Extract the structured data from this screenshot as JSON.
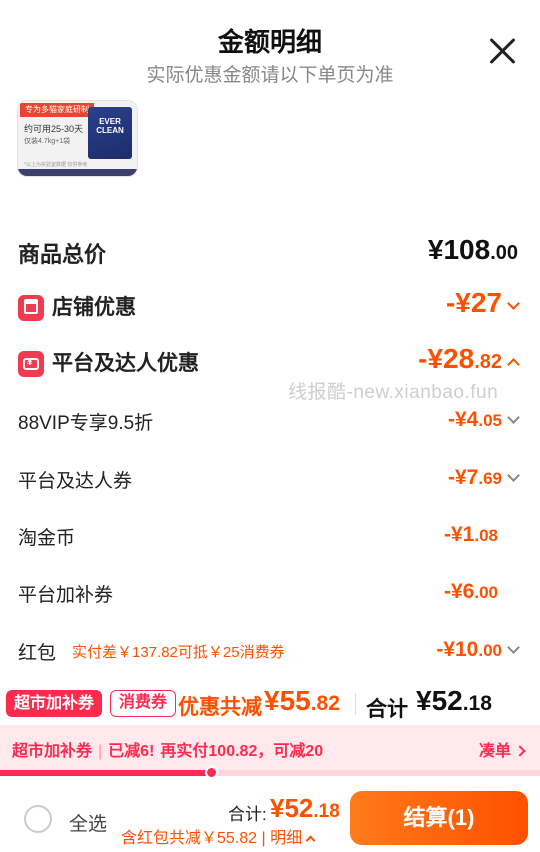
{
  "header": {
    "title": "金额明细",
    "subtitle": "实际优惠金额请以下单页为准"
  },
  "product": {
    "badge": "专为多猫家庭研制",
    "line1": "约可用25-30天",
    "line2": "仅装4.7kg+1袋",
    "brand": "EVER CLEAN",
    "fineprint": "*以上为实验室数据 仅供参考"
  },
  "summary": {
    "total_label": "商品总价",
    "total_int": "¥108",
    "total_dec": ".00",
    "shop_discount_label": "店铺优惠",
    "shop_discount_int": "-¥27",
    "platform_discount_label": "平台及达人优惠",
    "platform_discount_int": "-¥28",
    "platform_discount_dec": ".82"
  },
  "details": [
    {
      "label": "88VIP专享9.5折",
      "int": "-¥4",
      "dec": ".05"
    },
    {
      "label": "平台及达人券",
      "int": "-¥7",
      "dec": ".69"
    },
    {
      "label": "淘金币",
      "int": "-¥1",
      "dec": ".08"
    },
    {
      "label": "平台加补券",
      "int": "-¥6",
      "dec": ".00"
    },
    {
      "label": "红包",
      "note": "实付差￥137.82可抵￥25消费券",
      "int": "-¥10",
      "dec": ".00"
    }
  ],
  "watermark": "线报酷-new.xianbao.fun",
  "savings": {
    "tag1": "超市加补券",
    "tag2": "消费券",
    "text": "优惠共减",
    "amount_int": "¥55",
    "amount_dec": ".82",
    "total_label": "合计",
    "total_int": "¥52",
    "total_dec": ".18"
  },
  "promo": {
    "name": "超市加补券",
    "reduced": "已减6!",
    "more": "再实付100.82，可减20",
    "link": "凑单",
    "progress": 0.39
  },
  "footer": {
    "select_all": "全选",
    "total_label": "合计:",
    "total_int": "¥52",
    "total_dec": ".18",
    "detail": "含红包共减￥55.82 | 明细",
    "checkout": "结算(1)"
  },
  "colors": {
    "accent": "#ff5000",
    "promo_red": "#ff2b4f",
    "badge_red": "#f03a4e"
  }
}
